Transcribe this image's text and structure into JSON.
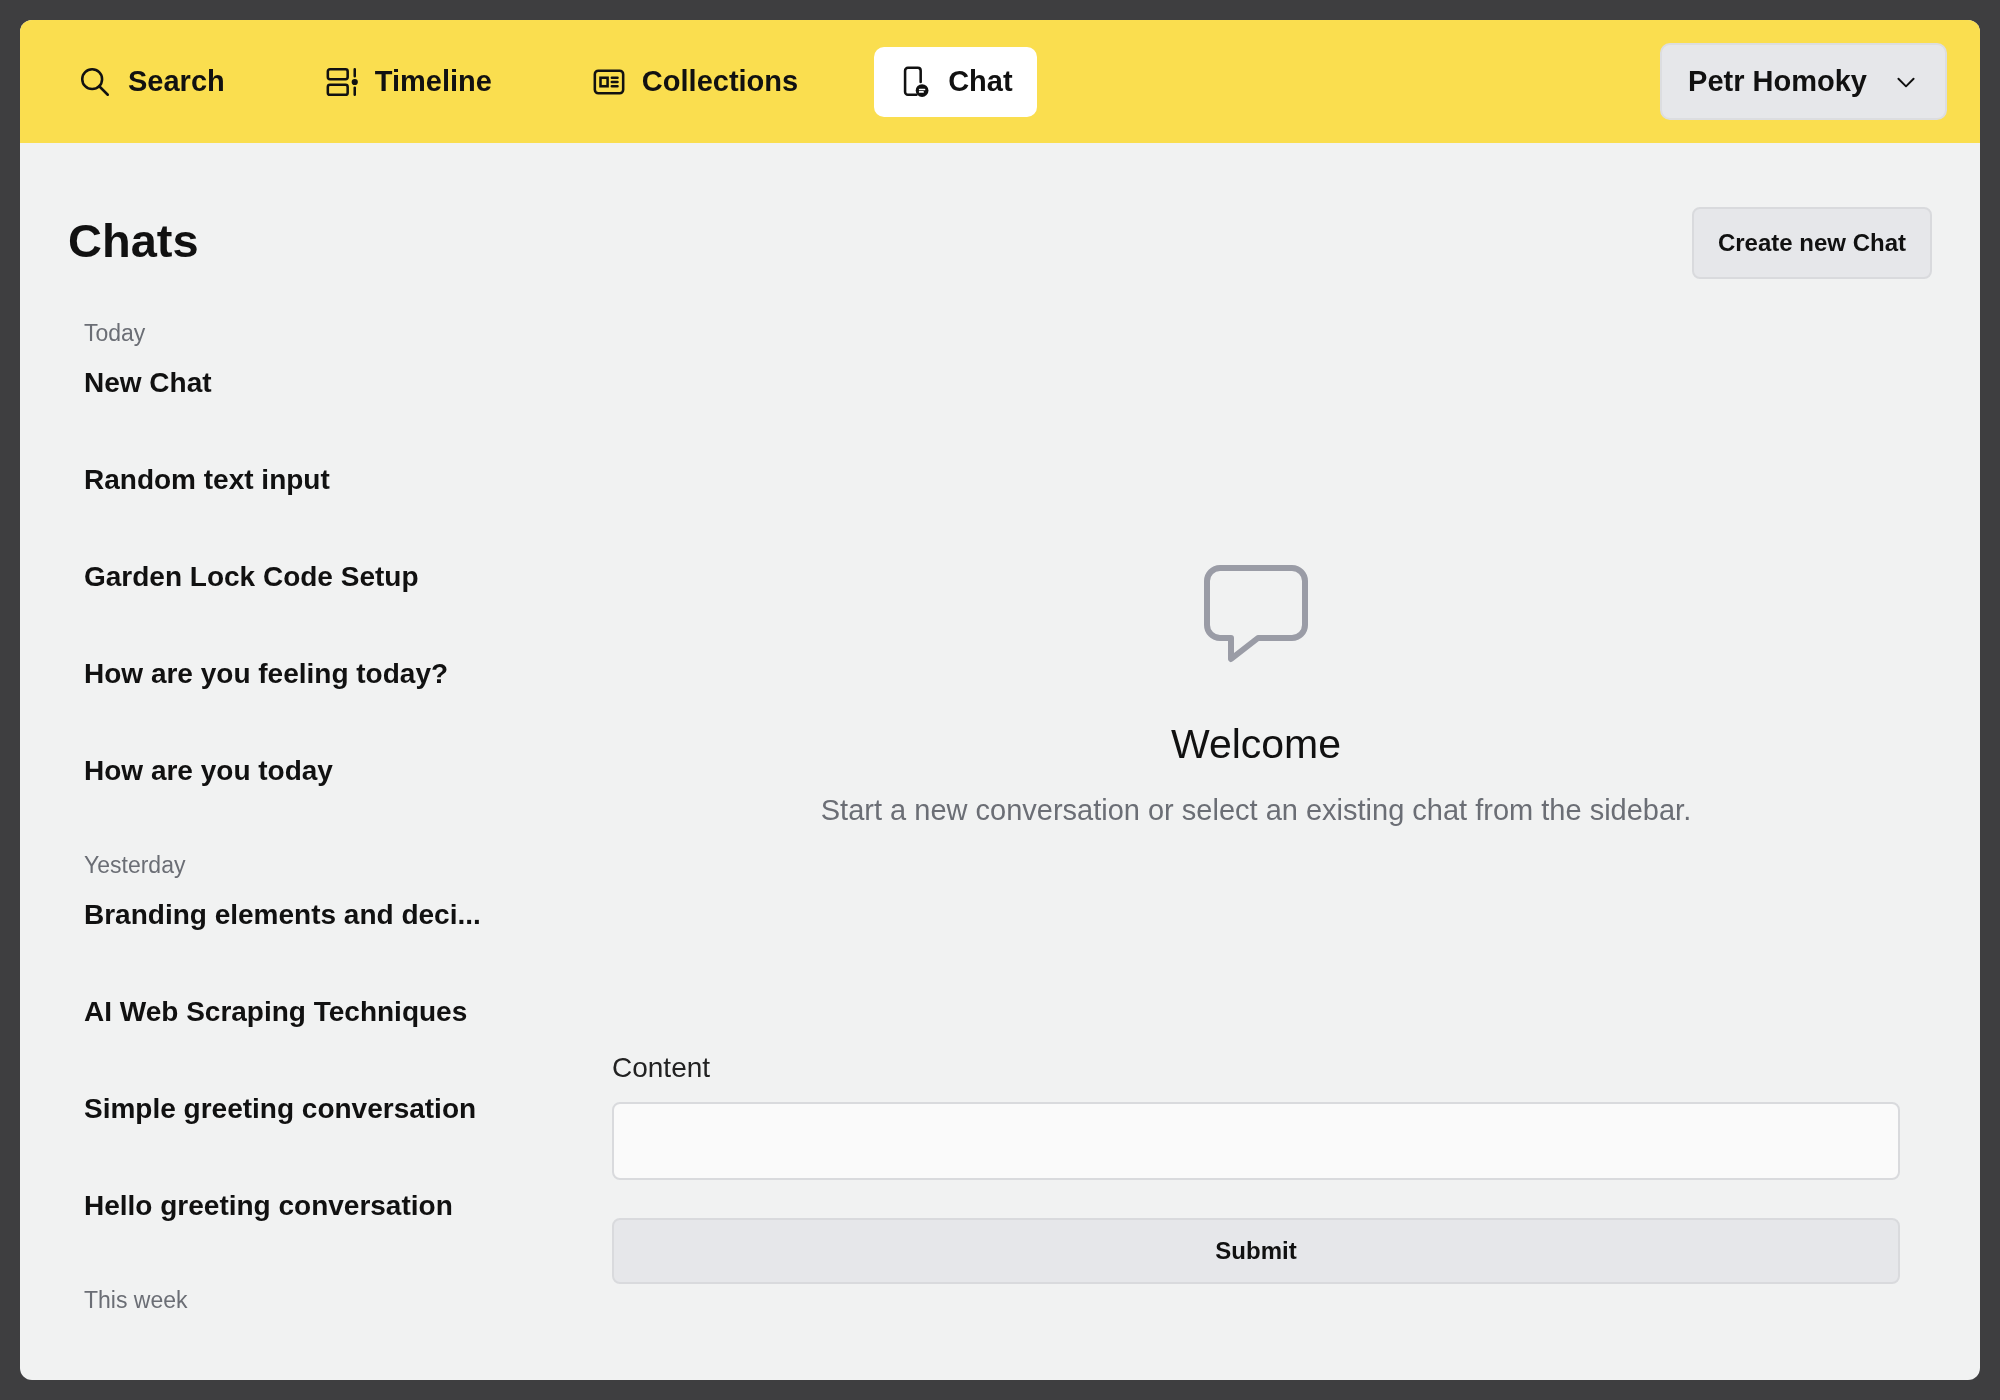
{
  "nav": {
    "items": [
      {
        "label": "Search",
        "selected": false
      },
      {
        "label": "Timeline",
        "selected": false
      },
      {
        "label": "Collections",
        "selected": false
      },
      {
        "label": "Chat",
        "selected": true
      }
    ],
    "user": "Petr Homoky"
  },
  "sidebar": {
    "title": "Chats",
    "groups": [
      {
        "label": "Today",
        "chats": [
          "New Chat",
          "Random text input",
          "Garden Lock Code Setup",
          "How are you feeling today?",
          "How are you today"
        ]
      },
      {
        "label": "Yesterday",
        "chats": [
          "Branding elements and deci...",
          "AI Web Scraping Techniques",
          "Simple greeting conversation",
          "Hello greeting conversation"
        ]
      },
      {
        "label": "This week"
      }
    ]
  },
  "main": {
    "create_button": "Create new Chat",
    "welcome_title": "Welcome",
    "welcome_text": "Start a new conversation or select an existing chat from the sidebar.",
    "form": {
      "label": "Content",
      "submit": "Submit"
    }
  }
}
